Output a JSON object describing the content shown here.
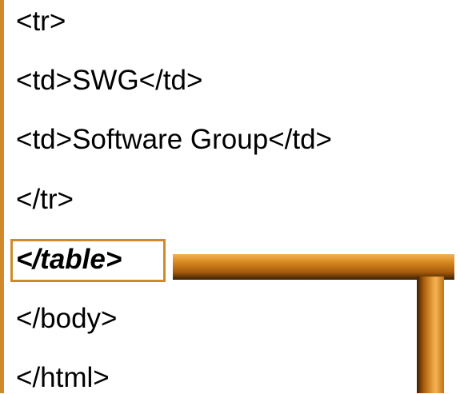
{
  "code_lines": [
    "<tr>",
    "<td>SWG</td>",
    "<td>Software Group</td>",
    "</tr>",
    "</table>",
    "</body>",
    "</html>"
  ],
  "highlight": {
    "text": "</table>",
    "style": "bold-italic",
    "color": "#d08a2a"
  },
  "colors": {
    "accent": "#d08a2a",
    "text": "#000000",
    "background": "#ffffff"
  }
}
